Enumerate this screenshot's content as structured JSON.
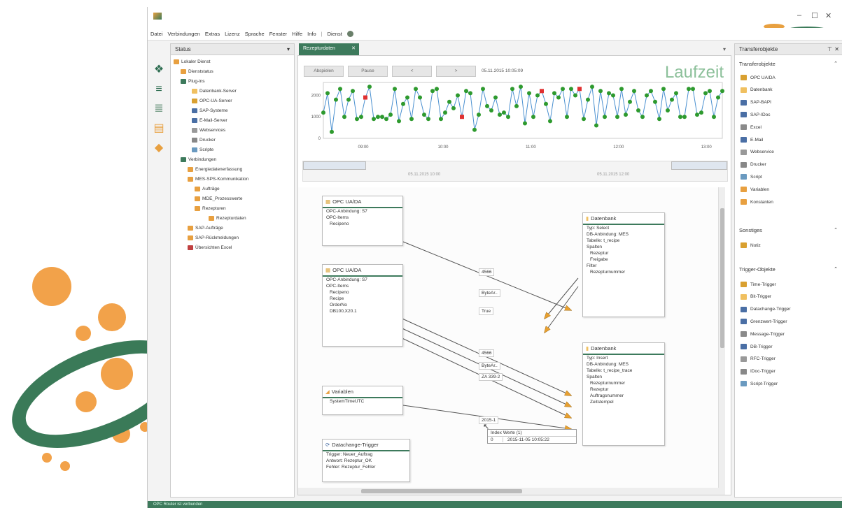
{
  "menu": {
    "items": [
      "Datei",
      "Verbindungen",
      "Extras",
      "Lizenz",
      "Sprache",
      "Fenster",
      "Hilfe",
      "Info"
    ],
    "dienst_label": "Dienst"
  },
  "window_controls": {
    "minimize": "–",
    "maximize": "☐",
    "close": "✕"
  },
  "status_panel": {
    "title": "Status",
    "tree": [
      "Lokaler Dienst",
      "Dienststatus",
      "Plug-ins",
      "Datenbank-Server",
      "OPC-UA-Server",
      "SAP-Systeme",
      "E-Mail-Server",
      "Webservices",
      "Drucker",
      "Scripte",
      "Verbindungen",
      "Energiedatenerfassung",
      "MES-SPS-Kommunikation",
      "Aufträge",
      "MDE_Prozesswerte",
      "Rezepturen",
      "Rezepturdaten",
      "SAP-Aufträge",
      "SAP-Rückmeldungen",
      "Übersichten Excel"
    ]
  },
  "tab": {
    "label": "Rezepturdaten"
  },
  "toolbar": {
    "btn1": "Abspielen",
    "btn2": "Pause",
    "btn3": "<",
    "btn4": ">",
    "timestamp": "05.11.2015 10:05:09"
  },
  "laufzeit": "Laufzeit",
  "chart_data": {
    "type": "line",
    "x_ticks": [
      "09:00",
      "10:00",
      "11:00",
      "12:00",
      "13:00"
    ],
    "y_ticks": [
      0,
      1000,
      2000
    ],
    "ylim": [
      0,
      2600
    ],
    "series": [
      {
        "values": [
          1200,
          2100,
          300,
          1800,
          2300,
          1000,
          1800,
          2200,
          900,
          1000,
          1900,
          2400,
          900,
          1000,
          1000,
          900,
          1100,
          2300,
          800,
          1600,
          1900,
          900,
          2300,
          1900,
          1100,
          900,
          2200,
          2300,
          900,
          1200,
          1700,
          1400,
          2000,
          1000,
          2200,
          2100,
          400,
          1100,
          2300,
          1500,
          1300,
          1900,
          1100,
          1200,
          1000,
          2300,
          1500,
          2400,
          700,
          2100,
          1000,
          2000,
          2200,
          1600,
          800,
          2100,
          1900,
          2300,
          1000,
          2300,
          2000,
          2300,
          900,
          1800,
          2400,
          600,
          2200,
          1000,
          2100,
          2000,
          1000,
          2300,
          1100,
          1700,
          2200,
          1300,
          1000,
          2000,
          2200,
          1700,
          900,
          2300,
          1300,
          1800,
          2100,
          1000,
          1000,
          2300,
          2300,
          1100,
          1200,
          2100,
          2200,
          1000,
          1900,
          2200
        ]
      }
    ],
    "marker_colors": {
      "normal": "#2e9a2e",
      "alarm": "#e03030",
      "line": "#4a90d0"
    },
    "timeline_left": "05.11.2015 10:00",
    "timeline_right": "05.11.2015 12:00"
  },
  "diagram": {
    "node1": {
      "title": "OPC UA/DA",
      "lines": [
        "OPC-Anbindung: S7",
        "OPC-Items",
        "Recipeno"
      ]
    },
    "node2": {
      "title": "OPC UA/DA",
      "lines": [
        "OPC-Anbindung: S7",
        "OPC-Items",
        "Recipeno",
        "Recipe",
        "OrderNo",
        "DB100,X20.1"
      ]
    },
    "node3": {
      "title": "Variablen",
      "lines": [
        "SystemTimeUTC"
      ]
    },
    "node4": {
      "title": "Datachange-Trigger",
      "lines": [
        "Trigger: Neuer_Auftrag",
        "Antwort: Rezeptur_OK",
        "Fehler: Rezeptur_Fehler"
      ]
    },
    "node5": {
      "title": "Datenbank",
      "lines": [
        "Typ: Select",
        "DB-Anbindung: MES",
        "Tabelle: t_recipe",
        "Spalten",
        "Rezeptur",
        "Freigabe",
        "Filter",
        "Rezepturnummer"
      ]
    },
    "node6": {
      "title": "Datenbank",
      "lines": [
        "Typ: Insert",
        "DB-Anbindung: MES",
        "Tabelle: t_recipe_trace",
        "Spalten",
        "Rezepturnummer",
        "Rezeptur",
        "Auftragsnummer",
        "Zeitstempel"
      ]
    },
    "labels": [
      "4566",
      "ByteAr..",
      "True",
      "4566",
      "ByteAr..",
      "ZA 339-2",
      "2015-1"
    ],
    "tooltip": {
      "header": "Index Werte (1)",
      "index": "0",
      "value": "2015-11-05 10:05:22"
    }
  },
  "transfer_panel": {
    "title": "Transferobjekte",
    "section1": "Transferobjekte",
    "items1": [
      "OPC UA/DA",
      "Datenbank",
      "SAP-BAPI",
      "SAP-IDoc",
      "Excel",
      "E-Mail",
      "Webservice",
      "Drucker",
      "Script",
      "Variablen",
      "Konstanten"
    ],
    "section2": "Sonstiges",
    "items2": [
      "Notiz"
    ],
    "section3": "Trigger-Objekte",
    "items3": [
      "Time-Trigger",
      "Bit-Trigger",
      "Datachange-Trigger",
      "Grenzwert-Trigger",
      "Message-Trigger",
      "DB-Trigger",
      "RFC-Trigger",
      "IDoc-Trigger",
      "Script-Trigger"
    ]
  },
  "statusbar": {
    "text": "OPC Router ist verbunden"
  }
}
